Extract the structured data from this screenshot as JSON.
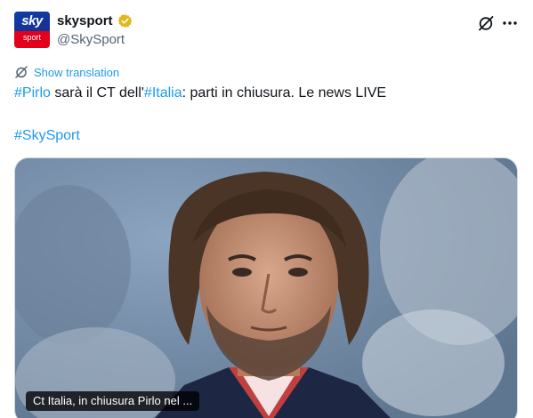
{
  "account": {
    "display_name": "skysport",
    "handle": "@SkySport",
    "avatar_top": "sky",
    "avatar_bottom": "sport"
  },
  "actions": {
    "grok_icon": "grok-icon",
    "more_icon": "more-icon"
  },
  "translation": {
    "label": "Show translation"
  },
  "tweet": {
    "hashtag_1": "#Pirlo",
    "text_1": " sarà il CT dell'",
    "hashtag_2": "#Italia",
    "text_2": ": parti in chiusura. Le news LIVE",
    "hashtag_3": "#SkySport"
  },
  "media": {
    "caption": "Ct Italia, in chiusura Pirlo nel ..."
  },
  "colors": {
    "link": "#1d9bf0",
    "text": "#0f1419",
    "secondary": "#536471",
    "brand_red": "#e2001a",
    "brand_blue": "#0b3fa8",
    "verified_gold": "#e2b719"
  }
}
